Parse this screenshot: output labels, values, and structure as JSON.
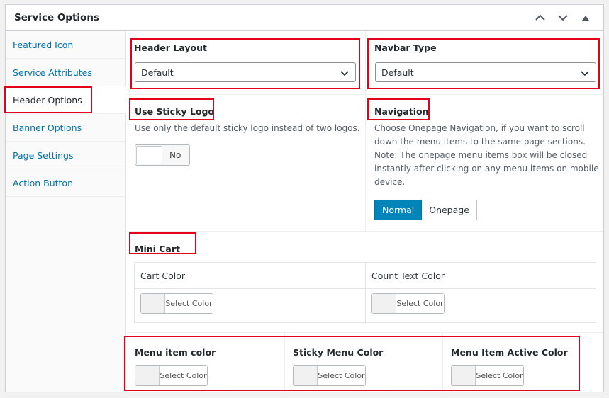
{
  "box": {
    "title": "Service Options"
  },
  "sidebar": {
    "items": [
      {
        "label": "Featured Icon"
      },
      {
        "label": "Service Attributes"
      },
      {
        "label": "Header Options"
      },
      {
        "label": "Banner Options"
      },
      {
        "label": "Page Settings"
      },
      {
        "label": "Action Button"
      }
    ],
    "active_index": 2
  },
  "header_layout": {
    "label": "Header Layout",
    "value": "Default"
  },
  "navbar_type": {
    "label": "Navbar Type",
    "value": "Default"
  },
  "sticky_logo": {
    "label": "Use Sticky Logo",
    "description": "Use only the default sticky logo instead of two logos.",
    "toggle_text": "No"
  },
  "navigation": {
    "label": "Navigation",
    "description_lines": [
      "Choose Onepage Navigation, if you want to scroll",
      "down the menu items to the same page sections.",
      "Note: The onepage menu items box will be closed",
      "instantly after clicking on any menu items on mobile",
      "device."
    ],
    "options": [
      "Normal",
      "Onepage"
    ],
    "selected": "Normal"
  },
  "mini_cart": {
    "label": "Mini Cart",
    "cart_color_label": "Cart Color",
    "count_text_color_label": "Count Text Color"
  },
  "menu_colors": {
    "menu_item_color_label": "Menu item color",
    "sticky_menu_color_label": "Sticky Menu Color",
    "menu_item_active_color_label": "Menu Item Active Color"
  },
  "color_button_label": "Select Color",
  "colors": {
    "accent": "#0085ba",
    "highlight_box": "#e2001a",
    "link": "#0073aa"
  }
}
